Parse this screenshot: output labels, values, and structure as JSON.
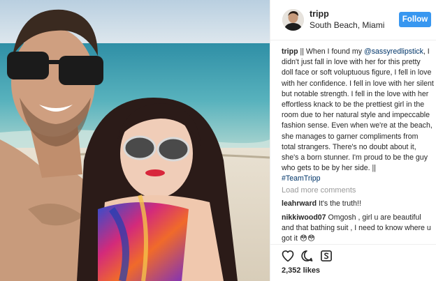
{
  "post": {
    "photo_icon": "selfie-photo"
  },
  "header": {
    "username": "tripp",
    "location": "South Beach, Miami",
    "follow_label": "Follow",
    "follow_color": "#3897f0"
  },
  "caption": {
    "username": "tripp",
    "text_before_mention": " || When I found my ",
    "mention": "@sassyredlipstick",
    "text_after_mention": ", I didn't just fall in love with her for this pretty doll face or soft voluptuous figure, I fell in love with her confidence. I fell in love with her silent but notable strength. I fell in the love with her effortless knack to be the prettiest girl in the room due to her natural style and impeccable fashion sense. Even when we're at the beach, she manages to garner compliments from total strangers. There's no doubt about it, she's a born stunner. I'm proud to be the guy who gets to be by her side. ||",
    "hashtag": "#TeamTripp",
    "link_color": "#003569"
  },
  "load_more": "Load more comments",
  "comments": [
    {
      "username": "leahrward",
      "text": " It's the truth!!"
    },
    {
      "username": "nikkiwood07",
      "text": " Omgosh , girl u are beautiful and that bathing suit , I need to know where u got it 😳😳"
    }
  ],
  "actions": {
    "like_icon": "heart-icon",
    "comment_icon": "comment-icon",
    "save_icon": "save-icon"
  },
  "likes": "2,352 likes"
}
